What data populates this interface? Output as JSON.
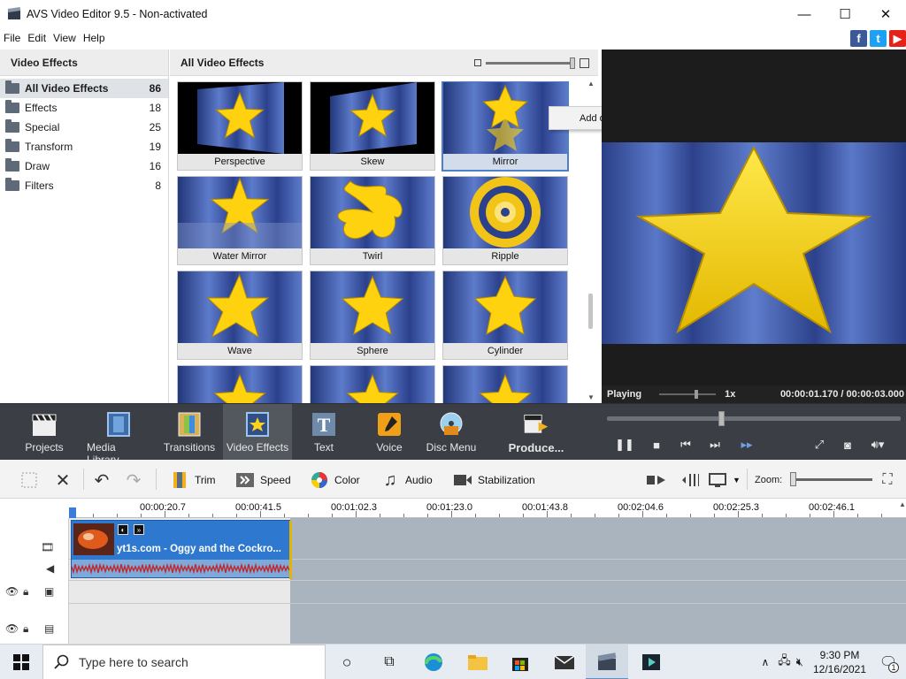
{
  "window": {
    "title": "AVS Video Editor 9.5 - Non-activated",
    "controls": {
      "minimize": "—",
      "maximize": "☐",
      "close": "✕"
    }
  },
  "menu": [
    "File",
    "Edit",
    "View",
    "Help"
  ],
  "social": [
    {
      "name": "facebook-icon",
      "glyph": "f",
      "color": "#3b5998"
    },
    {
      "name": "twitter-icon",
      "glyph": "t",
      "color": "#1da1f2"
    },
    {
      "name": "youtube-icon",
      "glyph": "▶",
      "color": "#e62117"
    }
  ],
  "left_panel": {
    "header": "Video Effects",
    "categories": [
      {
        "name": "All Video Effects",
        "count": "86",
        "active": true
      },
      {
        "name": "Effects",
        "count": "18"
      },
      {
        "name": "Special",
        "count": "25"
      },
      {
        "name": "Transform",
        "count": "19"
      },
      {
        "name": "Draw",
        "count": "16"
      },
      {
        "name": "Filters",
        "count": "8"
      }
    ]
  },
  "gallery": {
    "header": "All Video Effects",
    "tiles": [
      {
        "label": "Perspective",
        "style": "perspective"
      },
      {
        "label": "Skew",
        "style": "skew"
      },
      {
        "label": "Mirror",
        "style": "mirror",
        "selected": true
      },
      {
        "label": "Water Mirror",
        "style": "water"
      },
      {
        "label": "Twirl",
        "style": "twirl"
      },
      {
        "label": "Ripple",
        "style": "ripple"
      },
      {
        "label": "Wave",
        "style": "wave"
      },
      {
        "label": "Sphere",
        "style": "sphere"
      },
      {
        "label": "Cylinder",
        "style": "cylinder"
      },
      {
        "label": "",
        "style": "partial"
      },
      {
        "label": "",
        "style": "partial"
      },
      {
        "label": "",
        "style": "partial"
      }
    ]
  },
  "context_menu": {
    "item": "Add or Replace Video Effect"
  },
  "preview": {
    "status": "Playing",
    "speed": "1x",
    "time": "00:00:01.170 / 00:00:03.000"
  },
  "toolbar": {
    "items": [
      {
        "label": "Projects",
        "icon": "clapperboard-icon"
      },
      {
        "label": "Media Library",
        "icon": "film-icon"
      },
      {
        "label": "Transitions",
        "icon": "transitions-icon"
      },
      {
        "label": "Video Effects",
        "icon": "star-film-icon",
        "active": true
      },
      {
        "label": "Text",
        "icon": "text-icon"
      },
      {
        "label": "Voice",
        "icon": "microphone-icon"
      },
      {
        "label": "Disc Menu",
        "icon": "disc-icon"
      },
      {
        "label": "Produce...",
        "icon": "produce-icon"
      }
    ]
  },
  "edit_toolbar": {
    "trim": "Trim",
    "speed": "Speed",
    "color": "Color",
    "audio": "Audio",
    "stabilization": "Stabilization",
    "zoom": "Zoom:"
  },
  "timeline": {
    "ticks": [
      "00:00:20.7",
      "00:00:41.5",
      "00:01:02.3",
      "00:01:23.0",
      "00:01:43.8",
      "00:02:04.6",
      "00:02:25.3",
      "00:02:46.1"
    ],
    "clip_name": "yt1s.com - Oggy and the Cockro..."
  },
  "taskbar": {
    "search_placeholder": "Type here to search",
    "time": "9:30 PM",
    "date": "12/16/2021",
    "notifications": "1"
  }
}
